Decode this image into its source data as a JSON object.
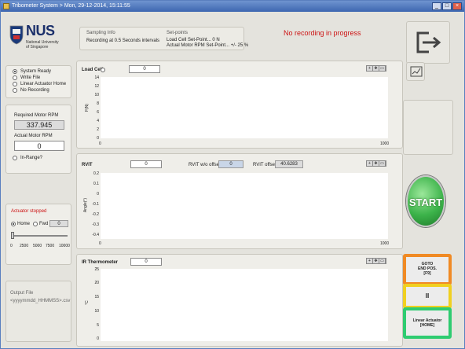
{
  "window": {
    "title": "Tribometer System > Mon, 29-12-2014, 15:11:55"
  },
  "logo": {
    "name": "NUS",
    "line1": "National University",
    "line2": "of Singapore"
  },
  "info": {
    "sampling_title": "Sampling Info",
    "sampling_text": "Recording at 0.5 Seconds intervals",
    "setpoints_title": "Set-points",
    "setpoint_line1": "Load Cell Set-Point... 0 N",
    "setpoint_line2": "Actual Motor RPM Set-Point... +/- 25 %"
  },
  "status_message": "No recording in progress",
  "status_color": "#cc1111",
  "states": [
    {
      "label": "System Ready",
      "selected": true
    },
    {
      "label": "Write File",
      "selected": false
    },
    {
      "label": "Linear Actuator Home",
      "selected": false
    },
    {
      "label": "No Recording",
      "selected": false
    }
  ],
  "rpm": {
    "required_label": "Required Motor RPM",
    "required_value": "337.945",
    "actual_label": "Actual Motor RPM",
    "actual_value": "0",
    "inrange_label": "In-Range?"
  },
  "actuator": {
    "status": "Actuator stopped",
    "status_color": "#cc1111",
    "home_label": "Home",
    "fwd_label": "Fwd",
    "position_value": "0",
    "slider_ticks": [
      "0",
      "2500",
      "5000",
      "7500",
      "10000"
    ],
    "slider_value": 0
  },
  "output": {
    "label": "Output File",
    "pattern": "<yyyymmdd_HHMMSS>.csv"
  },
  "graphs": {
    "load_cell": {
      "title": "Load Cell",
      "value": "0",
      "ylabel": "F(N)",
      "yticks": [
        "14",
        "12",
        "10",
        "8",
        "6",
        "4",
        "2",
        "0"
      ],
      "xticks": [
        "0",
        "1000"
      ]
    },
    "rvit": {
      "title": "RVIT",
      "value": "0",
      "nobias_label": "RVIT w/o offset",
      "nobias_value": "0",
      "offset_label": "RVIT offset",
      "offset_value": "40.6283",
      "ylabel": "Angle(°)",
      "yticks": [
        "0.2",
        "0.1",
        "0",
        "-0.1",
        "-0.2",
        "-0.3",
        "-0.4"
      ],
      "xticks": [
        "0",
        "1000"
      ]
    },
    "ir": {
      "title": "IR Thermometer",
      "value": "0",
      "ylabel": "°C",
      "yticks": [
        "25",
        "20",
        "15",
        "10",
        "5",
        "0"
      ],
      "xticks": [
        "0",
        "1000"
      ]
    }
  },
  "buttons": {
    "start": "START",
    "goto_line1": "GOTO",
    "goto_line2": "END POS.",
    "goto_line3": "[F9]",
    "pause": "II",
    "home_line1": "Linear Actuator",
    "home_line2": "[HOME]"
  },
  "colors": {
    "goto_border": "#f08a24",
    "pause_border": "#f0d020",
    "home_border": "#2ecc71",
    "start_green": "#3cb34a"
  }
}
